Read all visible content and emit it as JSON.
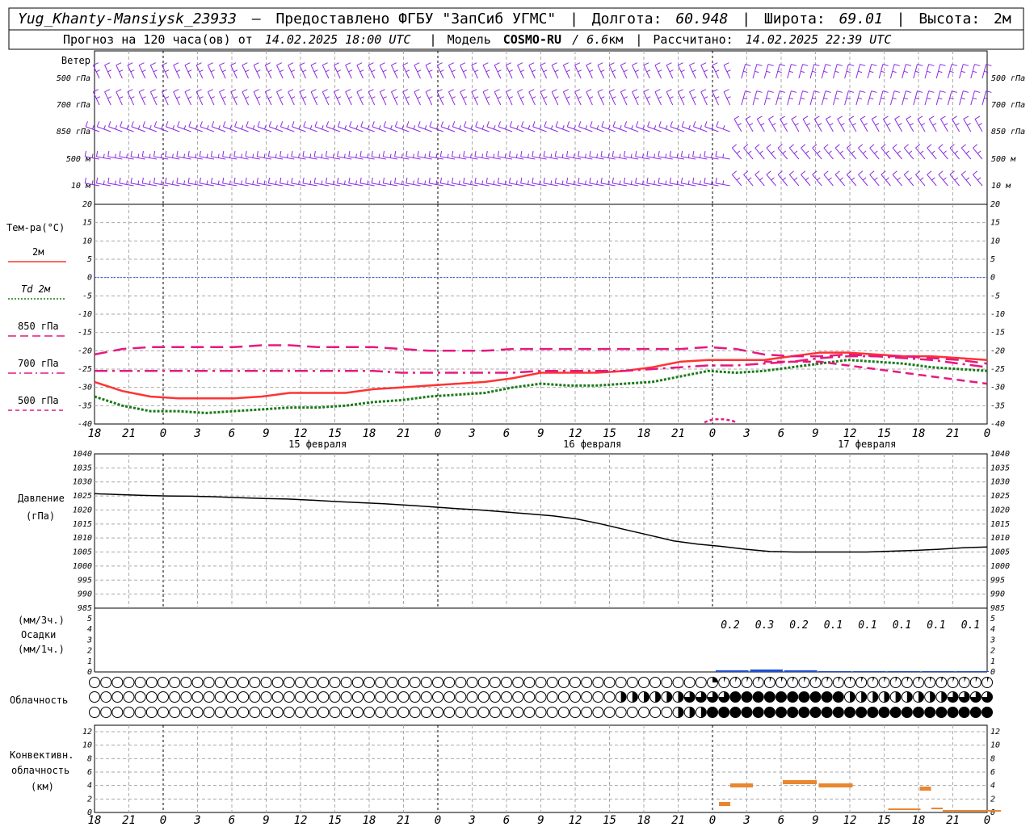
{
  "header": {
    "station": "Yug_Khanty-Mansiysk_23933",
    "dash": "—",
    "provider": "Предоставлено ФГБУ \"ЗапСиб УГМС\"",
    "lon_label": "Долгота:",
    "lon_value": "60.948",
    "lat_label": "Широта:",
    "lat_value": "69.01",
    "alt_label": "Высота:",
    "alt_value": "2м",
    "forecast_prefix": "Прогноз на 120 часа(ов) от",
    "forecast_time": "14.02.2025 18:00 UTC",
    "model_label": "Модель",
    "model_name": "COSMO-RU",
    "model_res": "/ 6.6",
    "model_res_unit": "км",
    "computed_label": "Рассчитано:",
    "computed_time": "14.02.2025 22:39 UTC"
  },
  "wind_panel": {
    "title": "Ветер",
    "levels": [
      "500 гПа",
      "700 гПа",
      "850 гПа",
      "500 м",
      "10  м"
    ],
    "barb_color": "#8a2be2"
  },
  "temp_panel": {
    "title": "Тем-ра(°С)",
    "legend": [
      {
        "label": "2м",
        "color": "#ff3333",
        "style": "solid"
      },
      {
        "label": "Td  2м",
        "color": "#1a7a1a",
        "style": "dotted"
      },
      {
        "label": "850 гПа",
        "color": "#e6197f",
        "style": "dash"
      },
      {
        "label": "700 гПа",
        "color": "#e6197f",
        "style": "dashdot"
      },
      {
        "label": "500 гПа",
        "color": "#e6197f",
        "style": "shortdash"
      }
    ],
    "y_ticks": [
      "20",
      "15",
      "10",
      "5",
      "0",
      "-5",
      "-10",
      "-15",
      "-20",
      "-25",
      "-30",
      "-35",
      "-40"
    ]
  },
  "x_axis": {
    "hour_labels": [
      "18",
      "21",
      "0",
      "3",
      "6",
      "9",
      "12",
      "15",
      "18",
      "21",
      "0",
      "3",
      "6",
      "9",
      "12",
      "15",
      "18",
      "21",
      "0",
      "3",
      "6",
      "9",
      "12",
      "15",
      "18",
      "21",
      "0"
    ],
    "date_labels": [
      "15 февраля",
      "16 февраля",
      "17 февраля"
    ]
  },
  "pressure_panel": {
    "title": "Давление",
    "unit": "(гПа)",
    "y_ticks": [
      "1040",
      "1035",
      "1030",
      "1025",
      "1020",
      "1015",
      "1010",
      "1005",
      "1000",
      "995",
      "990",
      "985"
    ]
  },
  "precip_panel": {
    "unit3": "(мм/3ч.)",
    "title": "Осадки",
    "unit1": "(мм/1ч.)",
    "y_ticks": [
      "5",
      "4",
      "3",
      "2",
      "1",
      "0"
    ],
    "amount_labels": [
      "0.2",
      "0.3",
      "0.2",
      "0.1",
      "0.1",
      "0.1",
      "0.1",
      "0.1"
    ]
  },
  "cloud_panel": {
    "title": "Облачность"
  },
  "conv_panel": {
    "title1": "Конвективн.",
    "title2": "облачность",
    "unit": "(км)",
    "y_ticks": [
      "12",
      "10",
      "8",
      "6",
      "4",
      "2",
      "0"
    ]
  },
  "chart_data": [
    {
      "type": "line",
      "title": "Тем-ра(°С)",
      "x_hours": [
        0,
        3,
        6,
        9,
        12,
        15,
        18,
        21,
        24,
        27,
        30,
        33,
        36,
        39,
        42,
        45,
        48,
        51,
        54,
        57,
        60,
        63,
        66,
        69,
        72,
        75,
        78
      ],
      "ylim": [
        -40,
        20
      ],
      "series": [
        {
          "name": "2м",
          "values": [
            -28.5,
            -31,
            -32.5,
            -33,
            -33,
            -33,
            -32.5,
            -31.5,
            -31.5,
            -31.5,
            -30.5,
            -30,
            -29.5,
            -29,
            -28.5,
            -27.5,
            -26,
            -26,
            -26,
            -25.5,
            -24.5,
            -23,
            -22.5,
            -22.5,
            -22.5,
            -21.5,
            -20.5,
            -20.5,
            -21,
            -21.5,
            -21.5,
            -22,
            -22.5
          ]
        },
        {
          "name": "Td  2м",
          "values": [
            -32.5,
            -35,
            -36.5,
            -36.5,
            -37,
            -36.5,
            -36,
            -35.5,
            -35.5,
            -35,
            -34,
            -33.5,
            -32.5,
            -32,
            -31.5,
            -30,
            -29,
            -29.5,
            -29.5,
            -29,
            -28.5,
            -27,
            -25.5,
            -26,
            -25.5,
            -24.5,
            -23.5,
            -22.5,
            -23,
            -23.5,
            -24.5,
            -25,
            -25.5
          ]
        },
        {
          "name": "850 гПа",
          "values": [
            -21,
            -19.5,
            -19,
            -19,
            -19,
            -19,
            -18.5,
            -18.5,
            -19,
            -19,
            -19,
            -19.5,
            -20,
            -20,
            -20,
            -19.5,
            -19.5,
            -19.5,
            -19.5,
            -19.5,
            -19.5,
            -19.5,
            -19,
            -19.5,
            -21,
            -21.5,
            -21.5,
            -21,
            -21.5,
            -21.5,
            -22,
            -22.5,
            -23.5
          ]
        },
        {
          "name": "700 гПа",
          "values": [
            -25.5,
            -25.5,
            -25.5,
            -25.5,
            -25.5,
            -25.5,
            -25.5,
            -25.5,
            -25.5,
            -25.5,
            -25.5,
            -26,
            -26,
            -26,
            -26,
            -26,
            -25.5,
            -25.5,
            -25.5,
            -25.5,
            -25,
            -24.5,
            -24,
            -24,
            -23.5,
            -23,
            -22,
            -21.5,
            -21.5,
            -22,
            -22.5,
            -23.5,
            -24.5
          ]
        },
        {
          "name": "500 гПа",
          "values": [
            null,
            null,
            null,
            null,
            null,
            null,
            null,
            null,
            null,
            null,
            null,
            null,
            null,
            null,
            null,
            null,
            null,
            null,
            null,
            null,
            null,
            null,
            null,
            null,
            -23,
            -23,
            -23,
            -24,
            -25,
            -26,
            -27,
            -28,
            -29
          ]
        }
      ]
    },
    {
      "type": "line",
      "title": "Давление",
      "ylabel": "(гПа)",
      "ylim": [
        985,
        1040
      ],
      "values": [
        1025.8,
        1025.5,
        1025.2,
        1025,
        1024.9,
        1024.7,
        1024.4,
        1024.1,
        1023.9,
        1023.5,
        1023,
        1022.6,
        1022.2,
        1021.7,
        1021.1,
        1020.5,
        1020,
        1019.3,
        1018.6,
        1017.9,
        1016.8,
        1015,
        1013,
        1011,
        1009,
        1007.8,
        1007,
        1006,
        1005.2,
        1005,
        1005,
        1005,
        1005,
        1005.3,
        1005.6,
        1006,
        1006.5,
        1006.8
      ]
    },
    {
      "type": "bar",
      "title": "Осадки",
      "ylabel": "(мм/3ч.)",
      "categories": [
        "0",
        "3",
        "6",
        "9",
        "12",
        "15",
        "18",
        "21"
      ],
      "values": [
        0.2,
        0.3,
        0.2,
        0.1,
        0.1,
        0.1,
        0.1,
        0.1
      ]
    }
  ]
}
